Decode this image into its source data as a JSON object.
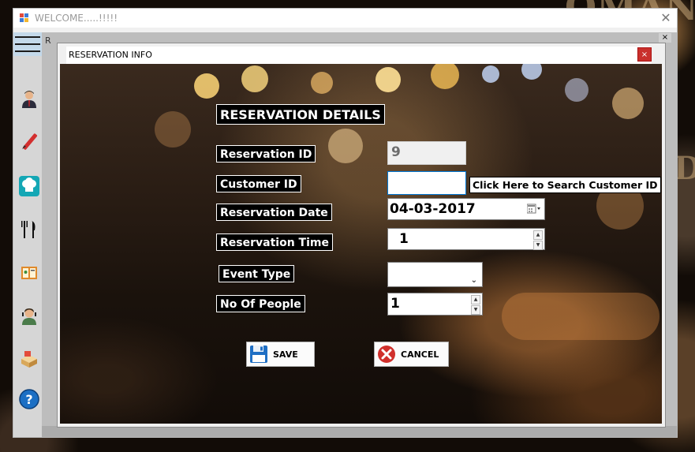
{
  "main_window": {
    "title": "WELCOME.....!!!!!",
    "close": "✕"
  },
  "background_text": [
    "OMAN",
    "D"
  ],
  "sidebar": {
    "items": [
      {
        "icon": "businessman-icon"
      },
      {
        "icon": "pen-icon"
      },
      {
        "icon": "chef-hat-icon"
      },
      {
        "icon": "fork-knife-icon"
      },
      {
        "icon": "menu-book-icon"
      },
      {
        "icon": "customer-icon"
      },
      {
        "icon": "boxes-icon"
      },
      {
        "icon": "help-icon"
      }
    ]
  },
  "ghost_title": "R",
  "ghost_close": "×",
  "form": {
    "title": "RESERVATION INFO",
    "close": "×",
    "heading": "RESERVATION DETAILS",
    "labels": {
      "reservation_id": "Reservation ID",
      "customer_id": "Customer ID",
      "reservation_date": "Reservation Date",
      "reservation_time": "Reservation Time",
      "event_type": "Event Type",
      "no_of_people": "No Of People"
    },
    "values": {
      "reservation_id": "9",
      "customer_id": "",
      "reservation_date": "04-03-2017",
      "reservation_time": "1",
      "event_type": "",
      "no_of_people": "1"
    },
    "search_hint": "Click Here to Search Customer ID",
    "buttons": {
      "save": "SAVE",
      "cancel": "CANCEL"
    }
  },
  "colors": {
    "accent": "#0078d7",
    "cancel_red": "#d0302c",
    "save_blue": "#1f6fc4"
  }
}
